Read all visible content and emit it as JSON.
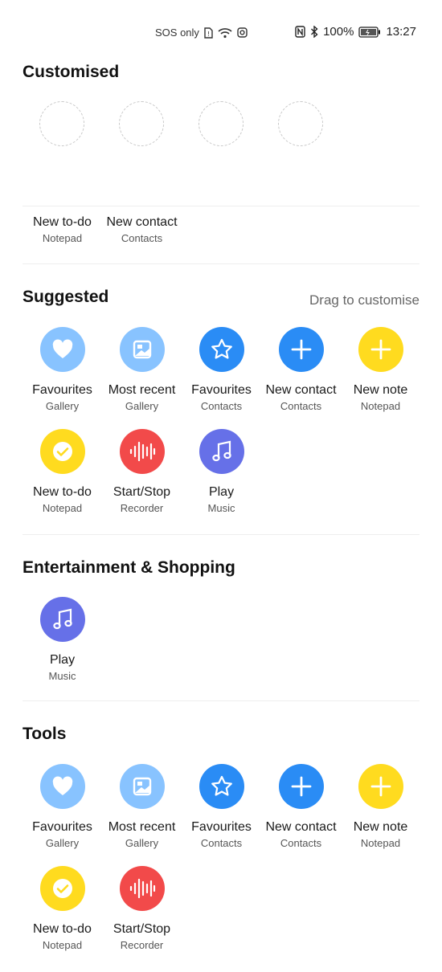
{
  "status_bar": {
    "left_text": "SOS only",
    "battery": "100%",
    "time": "13:27"
  },
  "colors": {
    "light_blue": "#88c3ff",
    "blue": "#2a8cf5",
    "yellow": "#ffdb1f",
    "red": "#f24a4a",
    "indigo": "#6670e8"
  },
  "sections": {
    "customised": {
      "title": "Customised",
      "shortcuts": [
        {
          "label": "New to-do",
          "app": "Notepad"
        },
        {
          "label": "New contact",
          "app": "Contacts"
        }
      ]
    },
    "suggested": {
      "title": "Suggested",
      "hint": "Drag to customise",
      "items": [
        {
          "label": "Favourites",
          "app": "Gallery",
          "icon": "heart-icon"
        },
        {
          "label": "Most recent",
          "app": "Gallery",
          "icon": "image-icon"
        },
        {
          "label": "Favourites",
          "app": "Contacts",
          "icon": "star-icon"
        },
        {
          "label": "New contact",
          "app": "Contacts",
          "icon": "plus-icon"
        },
        {
          "label": "New note",
          "app": "Notepad",
          "icon": "plus-icon"
        },
        {
          "label": "New to-do",
          "app": "Notepad",
          "icon": "check-icon"
        },
        {
          "label": "Start/Stop",
          "app": "Recorder",
          "icon": "waveform-icon"
        },
        {
          "label": "Play",
          "app": "Music",
          "icon": "music-note-icon"
        }
      ]
    },
    "entertainment": {
      "title": "Entertainment & Shopping",
      "items": [
        {
          "label": "Play",
          "app": "Music",
          "icon": "music-note-icon"
        }
      ]
    },
    "tools": {
      "title": "Tools",
      "items": [
        {
          "label": "Favourites",
          "app": "Gallery",
          "icon": "heart-icon"
        },
        {
          "label": "Most recent",
          "app": "Gallery",
          "icon": "image-icon"
        },
        {
          "label": "Favourites",
          "app": "Contacts",
          "icon": "star-icon"
        },
        {
          "label": "New contact",
          "app": "Contacts",
          "icon": "plus-icon"
        },
        {
          "label": "New note",
          "app": "Notepad",
          "icon": "plus-icon"
        },
        {
          "label": "New to-do",
          "app": "Notepad",
          "icon": "check-icon"
        },
        {
          "label": "Start/Stop",
          "app": "Recorder",
          "icon": "waveform-icon"
        }
      ]
    }
  }
}
